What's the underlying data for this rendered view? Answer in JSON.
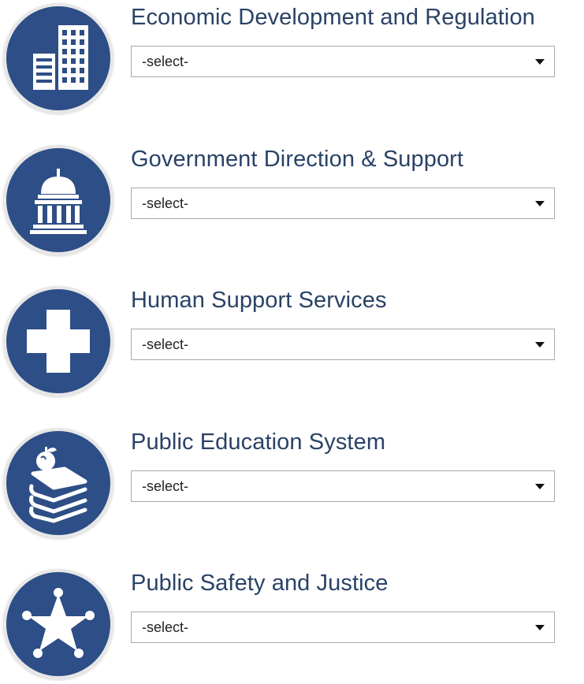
{
  "categories": [
    {
      "title": "Economic Development and Regulation",
      "icon": "buildings-icon",
      "select": {
        "selected": "-select-"
      }
    },
    {
      "title": "Government Direction & Support",
      "icon": "capitol-building-icon",
      "select": {
        "selected": "-select-"
      }
    },
    {
      "title": "Human Support Services",
      "icon": "medical-cross-icon",
      "select": {
        "selected": "-select-"
      }
    },
    {
      "title": "Public Education System",
      "icon": "books-apple-icon",
      "select": {
        "selected": "-select-"
      }
    },
    {
      "title": "Public Safety and Justice",
      "icon": "sheriff-badge-icon",
      "select": {
        "selected": "-select-"
      }
    }
  ],
  "colors": {
    "icon_background": "#2d4e86",
    "icon_ring": "#e7e7e7",
    "title_text": "#2a4266",
    "select_border": "#a9a9a9"
  }
}
